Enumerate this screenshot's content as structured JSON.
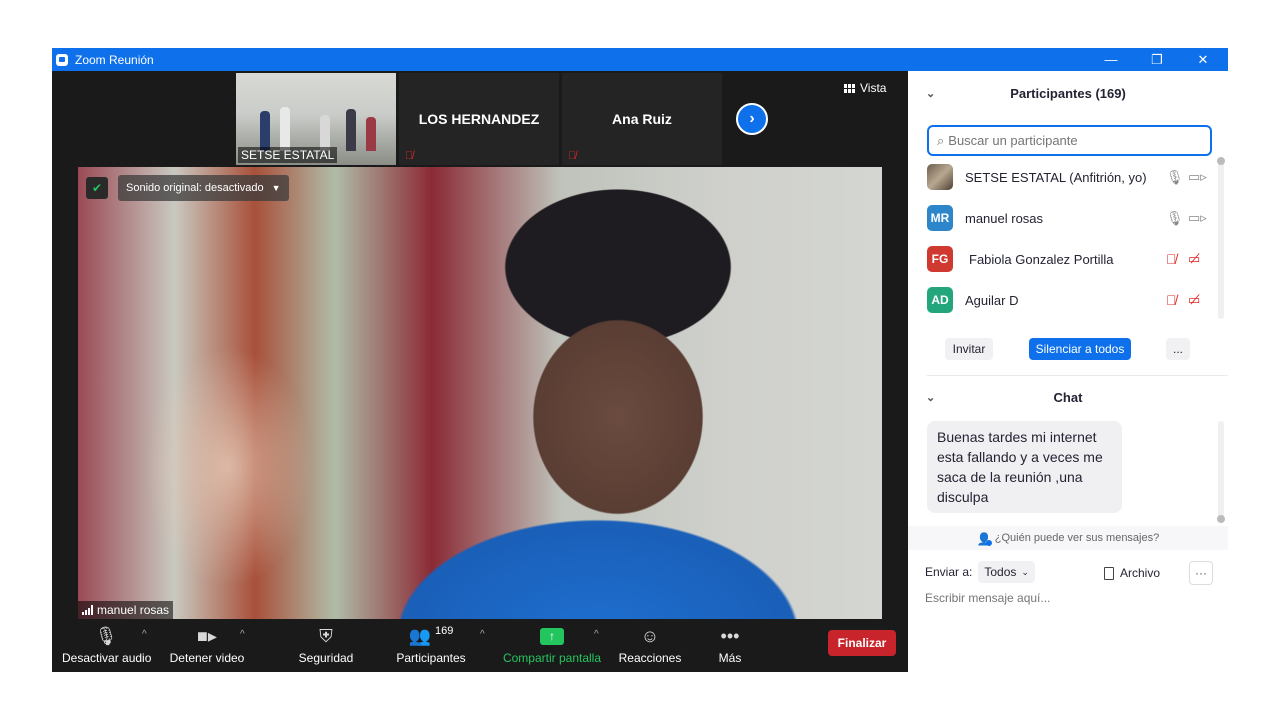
{
  "window": {
    "title": "Zoom Reunión",
    "controls": {
      "minimize": "—",
      "restore": "❐",
      "close": "✕"
    }
  },
  "strip": {
    "tiles": [
      {
        "name": "SETSE ESTATAL"
      },
      {
        "name": "LOS HERNANDEZ"
      },
      {
        "name": "Ana Ruiz"
      }
    ],
    "view_label": "Vista"
  },
  "video": {
    "sound_label": "Sonido original: desactivado",
    "speaker_name": "manuel rosas"
  },
  "toolbar": {
    "audio": "Desactivar audio",
    "video": "Detener video",
    "security": "Seguridad",
    "participants": "Participantes",
    "participants_count": "169",
    "share": "Compartir pantalla",
    "reactions": "Reacciones",
    "more": "Más",
    "end": "Finalizar"
  },
  "participants": {
    "title": "Participantes (169)",
    "search_placeholder": "Buscar un participante",
    "list": [
      {
        "initials": "",
        "name": "SETSE ESTATAL (Anfitrión, yo)",
        "color": "",
        "muted": false
      },
      {
        "initials": "MR",
        "name": "manuel rosas",
        "color": "#2d86c9",
        "muted": false
      },
      {
        "initials": "FG",
        "name": "Fabiola Gonzalez Portilla",
        "color": "#d0392f",
        "muted": true
      },
      {
        "initials": "AD",
        "name": "Aguilar D",
        "color": "#23a67c",
        "muted": true
      }
    ],
    "invite": "Invitar",
    "mute_all": "Silenciar a todos",
    "more": "..."
  },
  "chat": {
    "title": "Chat",
    "message": "Buenas tardes mi internet esta fallando y a veces me saca de la reunión ,una disculpa",
    "who_can_see": "¿Quién puede ver sus mensajes?",
    "send_to_label": "Enviar a:",
    "send_to_value": "Todos",
    "file": "Archivo",
    "more": "···",
    "input_placeholder": "Escribir mensaje aquí..."
  },
  "colors": {
    "accent": "#0e71eb",
    "end": "#c8242b",
    "share": "#23c55e",
    "muted": "#e02828"
  }
}
